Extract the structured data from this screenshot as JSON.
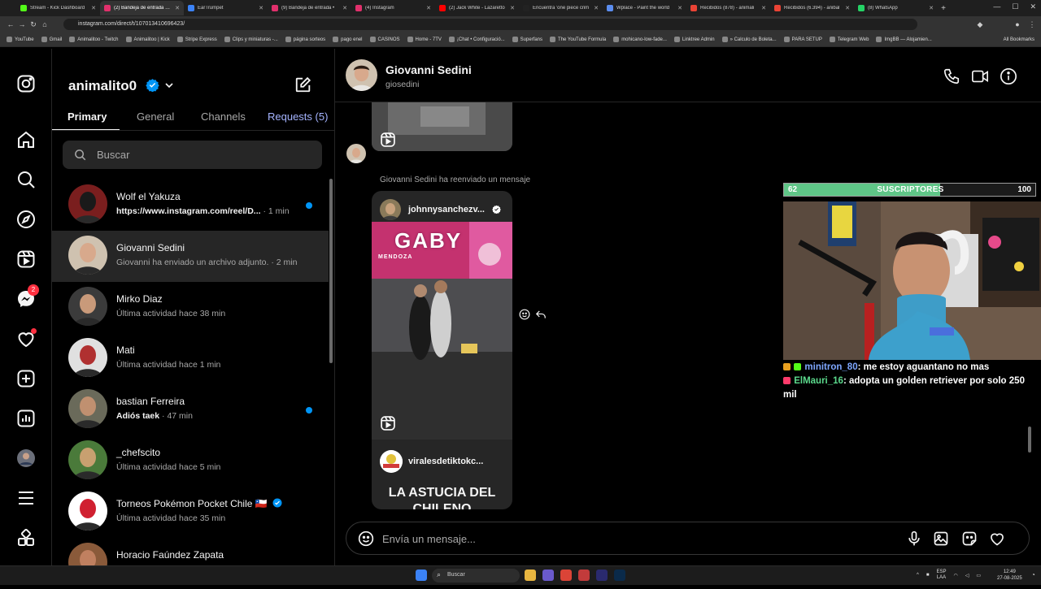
{
  "browser": {
    "tabs": [
      {
        "title": "Stream - Kick Dashboard",
        "color": "#53fc18"
      },
      {
        "title": "(2) Bandeja de entrada • C",
        "color": "#e1306c",
        "active": true
      },
      {
        "title": "EarTrumpet",
        "color": "#3b82f6"
      },
      {
        "title": "(9) Bandeja de entrada •",
        "color": "#e1306c"
      },
      {
        "title": "(4) Instagram",
        "color": "#e1306c"
      },
      {
        "title": "(2) Jack White - Lazaretto",
        "color": "#ff0000"
      },
      {
        "title": "Encuentra 'one piece crim",
        "color": "#222222"
      },
      {
        "title": "Wplace - Paint the world",
        "color": "#5b8def"
      },
      {
        "title": "Recibidos (878) - animali",
        "color": "#ea4335"
      },
      {
        "title": "Recibidos (6.394) - anibal",
        "color": "#ea4335"
      },
      {
        "title": "(8) WhatsApp",
        "color": "#25d366"
      }
    ],
    "url": "instagram.com/direct/t/107013410696423/",
    "bookmarks": [
      "YouTube",
      "Gmail",
      "Animalitoo - Twitch",
      "Animalitoo | Kick",
      "Stripe Express",
      "Clips y miniaturas -...",
      "página sorteos",
      "pago enel",
      "CASINOS",
      "Home - 7TV",
      "¡Chat • Configuració...",
      "Superfans",
      "The YouTube Formula",
      "mohicano-low-fade...",
      "Linktree Admin",
      "» Calculo de Boleta...",
      "PARA SETUP",
      "Telegram Web",
      "ImgBB — Alojamien..."
    ],
    "all_bookmarks": "All Bookmarks"
  },
  "rail": {
    "messages_badge": "2"
  },
  "inbox": {
    "username": "animalito0",
    "tabs": [
      "Primary",
      "General",
      "Channels",
      "Requests (5)"
    ],
    "search_placeholder": "Buscar",
    "conversations": [
      {
        "name": "Wolf el Yakuza",
        "preview": "https://www.instagram.com/reel/D...",
        "time": "· 1 min",
        "unread": true,
        "bold": true
      },
      {
        "name": "Giovanni Sedini",
        "preview": "Giovanni ha enviado un archivo adjunto.",
        "time": "· 2 min",
        "selected": true
      },
      {
        "name": "Mirko Diaz",
        "preview": "Última actividad hace 38 min",
        "time": ""
      },
      {
        "name": "Mati",
        "preview": "Última actividad hace 1 min",
        "time": ""
      },
      {
        "name": "bastian Ferreira",
        "preview": "Adiós taek",
        "time": "· 47 min",
        "unread": true,
        "bold": true
      },
      {
        "name": "_chefscito",
        "preview": "Última actividad hace 5 min",
        "time": ""
      },
      {
        "name": "Torneos Pokémon Pocket Chile 🇨🇱",
        "preview": "Última actividad hace 35 min",
        "time": "",
        "verified": true
      },
      {
        "name": "Horacio Faúndez Zapata",
        "preview": "",
        "time": ""
      }
    ]
  },
  "chat": {
    "name": "Giovanni Sedini",
    "handle": "giosedini",
    "forward_note": "Giovanni Sedini ha reenviado un mensaje",
    "reel_user": "johnnysanchezv...",
    "reel_video_text": "GABY",
    "reel_video_subtext": "MENDOZA",
    "reel_footer_user": "viralesdetiktokc...",
    "reel_caption": "LA ASTUCIA DEL CHILENO",
    "composer_placeholder": "Envía un mensaje..."
  },
  "overlay": {
    "sub_min": "62",
    "sub_title": "SUSCRIPTORES",
    "sub_max": "100",
    "sub_progress": 0.62,
    "chat": [
      {
        "user": "minitron_80",
        "text": "me estoy aguantano no mas",
        "color": "#7ea7ff"
      },
      {
        "user": "ElMauri_16",
        "text": "adopta un golden retriever por solo 250 mil",
        "color": "#5bd98c"
      }
    ]
  },
  "taskbar": {
    "search": "Buscar",
    "lang": "ESP",
    "lang2": "LAA",
    "time": "12:49",
    "date": "27-08-2025"
  }
}
